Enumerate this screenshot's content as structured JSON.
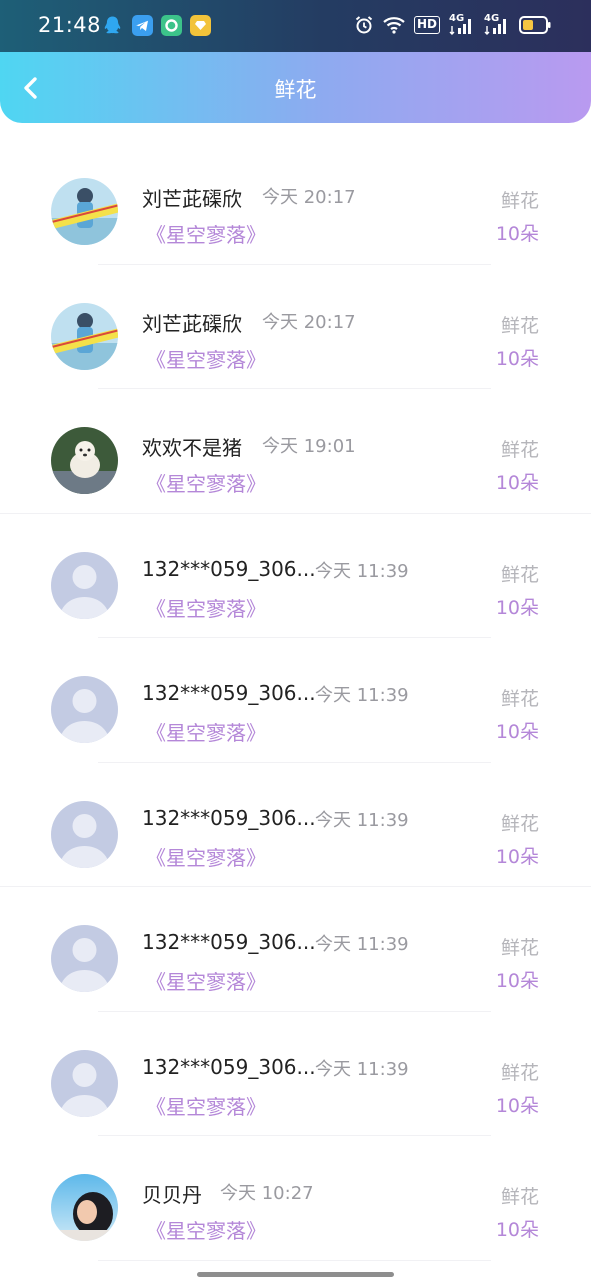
{
  "status_bar": {
    "time": "21:48",
    "hd_label": "HD",
    "signal_label_1": "4G",
    "signal_label_2": "4G"
  },
  "header": {
    "title": "鲜花"
  },
  "colors": {
    "accent_purple": "#b487d8",
    "header_start": "#4fd6f2",
    "header_end": "#b99af0"
  },
  "rows": [
    {
      "name": "刘芒茈磲欣",
      "time": "今天 20:17",
      "book": "《星空寥落》",
      "gift": "鲜花",
      "count": "10朵",
      "avatar": "photo-girl-banner"
    },
    {
      "name": "刘芒茈磲欣",
      "time": "今天 20:17",
      "book": "《星空寥落》",
      "gift": "鲜花",
      "count": "10朵",
      "avatar": "photo-girl-banner"
    },
    {
      "name": "欢欢不是猪",
      "time": "今天 19:01",
      "book": "《星空寥落》",
      "gift": "鲜花",
      "count": "10朵",
      "avatar": "photo-dog"
    },
    {
      "name": "132***059_306...",
      "time": "今天 11:39",
      "book": "《星空寥落》",
      "gift": "鲜花",
      "count": "10朵",
      "avatar": "default"
    },
    {
      "name": "132***059_306...",
      "time": "今天 11:39",
      "book": "《星空寥落》",
      "gift": "鲜花",
      "count": "10朵",
      "avatar": "default"
    },
    {
      "name": "132***059_306...",
      "time": "今天 11:39",
      "book": "《星空寥落》",
      "gift": "鲜花",
      "count": "10朵",
      "avatar": "default"
    },
    {
      "name": "132***059_306...",
      "time": "今天 11:39",
      "book": "《星空寥落》",
      "gift": "鲜花",
      "count": "10朵",
      "avatar": "default"
    },
    {
      "name": "132***059_306...",
      "time": "今天 11:39",
      "book": "《星空寥落》",
      "gift": "鲜花",
      "count": "10朵",
      "avatar": "default"
    },
    {
      "name": "贝贝丹",
      "time": "今天 10:27",
      "book": "《星空寥落》",
      "gift": "鲜花",
      "count": "10朵",
      "avatar": "photo-sky-child"
    }
  ]
}
